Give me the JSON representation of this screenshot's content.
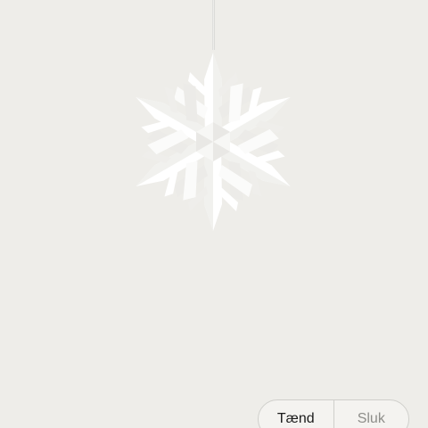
{
  "scene": {
    "background_color": "#eeede9",
    "ornament_icon": "snowflake-icon",
    "ornament_color": "#ffffff"
  },
  "toggle": {
    "on_label": "Tænd",
    "off_label": "Sluk",
    "selected": "on"
  }
}
